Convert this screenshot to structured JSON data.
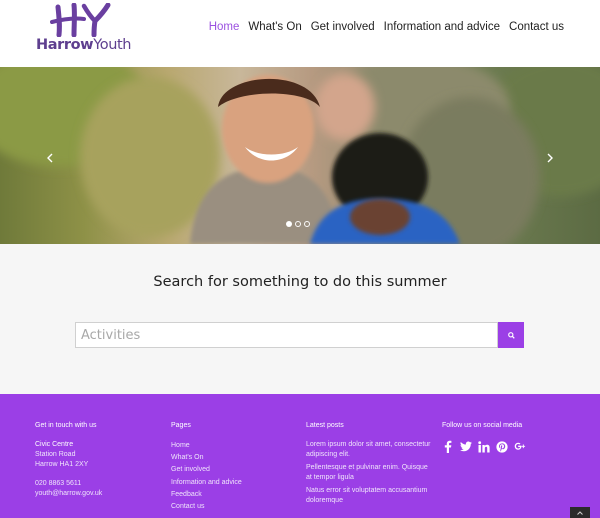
{
  "header": {
    "logo": {
      "mark": "HY",
      "text_part1": "Harrow",
      "text_part2": "Youth",
      "color": "#5e3f8f"
    },
    "nav": [
      {
        "label": "Home",
        "active": true
      },
      {
        "label": "What's On",
        "active": false
      },
      {
        "label": "Get involved",
        "active": false
      },
      {
        "label": "Information and advice",
        "active": false
      },
      {
        "label": "Contact us",
        "active": false
      }
    ],
    "accent_color": "#9b51e0"
  },
  "hero": {
    "prev_icon": "chevron-left-icon",
    "next_icon": "chevron-right-icon",
    "slide_count": 3,
    "active_slide": 1
  },
  "search": {
    "title": "Search for something to do this summer",
    "placeholder": "Activities",
    "button_icon": "search-icon",
    "button_color": "#9b3fe6"
  },
  "footer": {
    "background": "#9b3fe6",
    "contact": {
      "heading": "Get in touch with us",
      "address_name": "Civic Centre",
      "address_line1": "Station Road",
      "address_line2": "Harrow HA1 2XY",
      "phone": "020 8863 5611",
      "email": "youth@harrow.gov.uk"
    },
    "pages": {
      "heading": "Pages",
      "links": [
        "Home",
        "What's On",
        "Get involved",
        "Information and advice",
        "Feedback",
        "Contact us"
      ]
    },
    "posts": {
      "heading": "Latest posts",
      "items": [
        "Lorem ipsum dolor sit amet, consectetur adipiscing elit.",
        "Pellentesque et pulvinar enim. Quisque at tempor ligula",
        "Natus error sit voluptatem accusantium doloremque"
      ]
    },
    "social": {
      "heading": "Follow us on social media",
      "icons": [
        "facebook-icon",
        "twitter-icon",
        "linkedin-icon",
        "pinterest-icon",
        "google-plus-icon"
      ]
    }
  }
}
